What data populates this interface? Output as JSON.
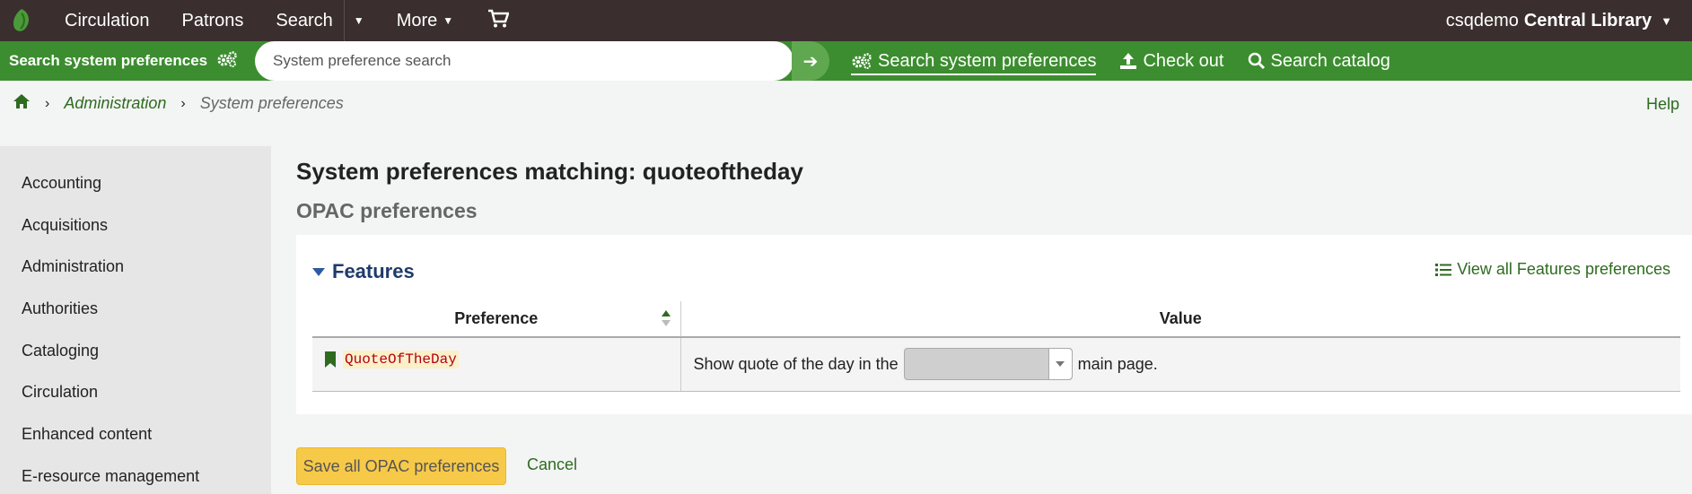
{
  "topnav": {
    "items": [
      "Circulation",
      "Patrons",
      "Search",
      "More"
    ],
    "user": "csqdemo",
    "library": "Central Library"
  },
  "searchbar": {
    "label": "Search system preferences",
    "placeholder": "System preference search",
    "links": [
      "Search system preferences",
      "Check out",
      "Search catalog"
    ]
  },
  "breadcrumb": {
    "items": [
      "Administration",
      "System preferences"
    ],
    "help": "Help"
  },
  "sidebar": {
    "items": [
      "Accounting",
      "Acquisitions",
      "Administration",
      "Authorities",
      "Cataloging",
      "Circulation",
      "Enhanced content",
      "E-resource management"
    ]
  },
  "main": {
    "title": "System preferences matching: quoteoftheday",
    "section": "OPAC preferences",
    "group": "Features",
    "view_all": "View all Features preferences",
    "columns": [
      "Preference",
      "Value"
    ],
    "rows": [
      {
        "name": "QuoteOfTheDay",
        "value_before": "Show quote of the day in the",
        "value_after": "main page.",
        "select_value": ""
      }
    ],
    "save_label": "Save all OPAC preferences",
    "cancel_label": "Cancel"
  },
  "colors": {
    "topnav_bg": "#3a2e2e",
    "search_bar_bg": "#3c8d2f",
    "link": "#2e6b1f",
    "save_button": "#f7c948"
  }
}
